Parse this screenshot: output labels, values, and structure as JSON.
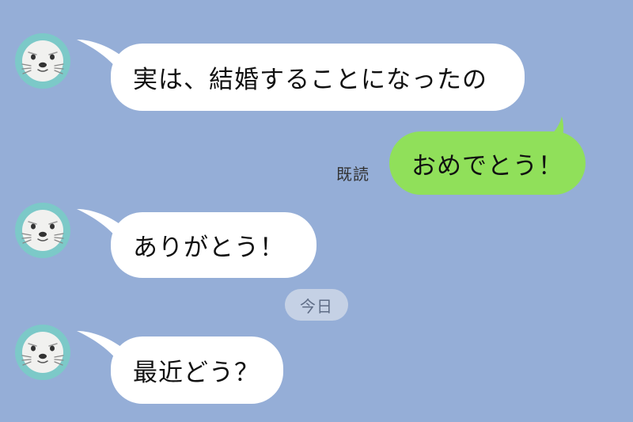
{
  "chat": {
    "colors": {
      "background": "#95aed7",
      "incoming_bubble": "#ffffff",
      "outgoing_bubble": "#90e05a",
      "date_pill": "#c5d1e5"
    },
    "contact_avatar_icon": "seal-avatar-icon",
    "messages": [
      {
        "direction": "incoming",
        "text": "実は、結婚することになったの"
      },
      {
        "direction": "outgoing",
        "text": "おめでとう！",
        "status": "既読"
      },
      {
        "direction": "incoming",
        "text": "ありがとう！"
      }
    ],
    "date_separator": "今日",
    "messages_after_separator": [
      {
        "direction": "incoming",
        "text": "最近どう？"
      }
    ]
  }
}
